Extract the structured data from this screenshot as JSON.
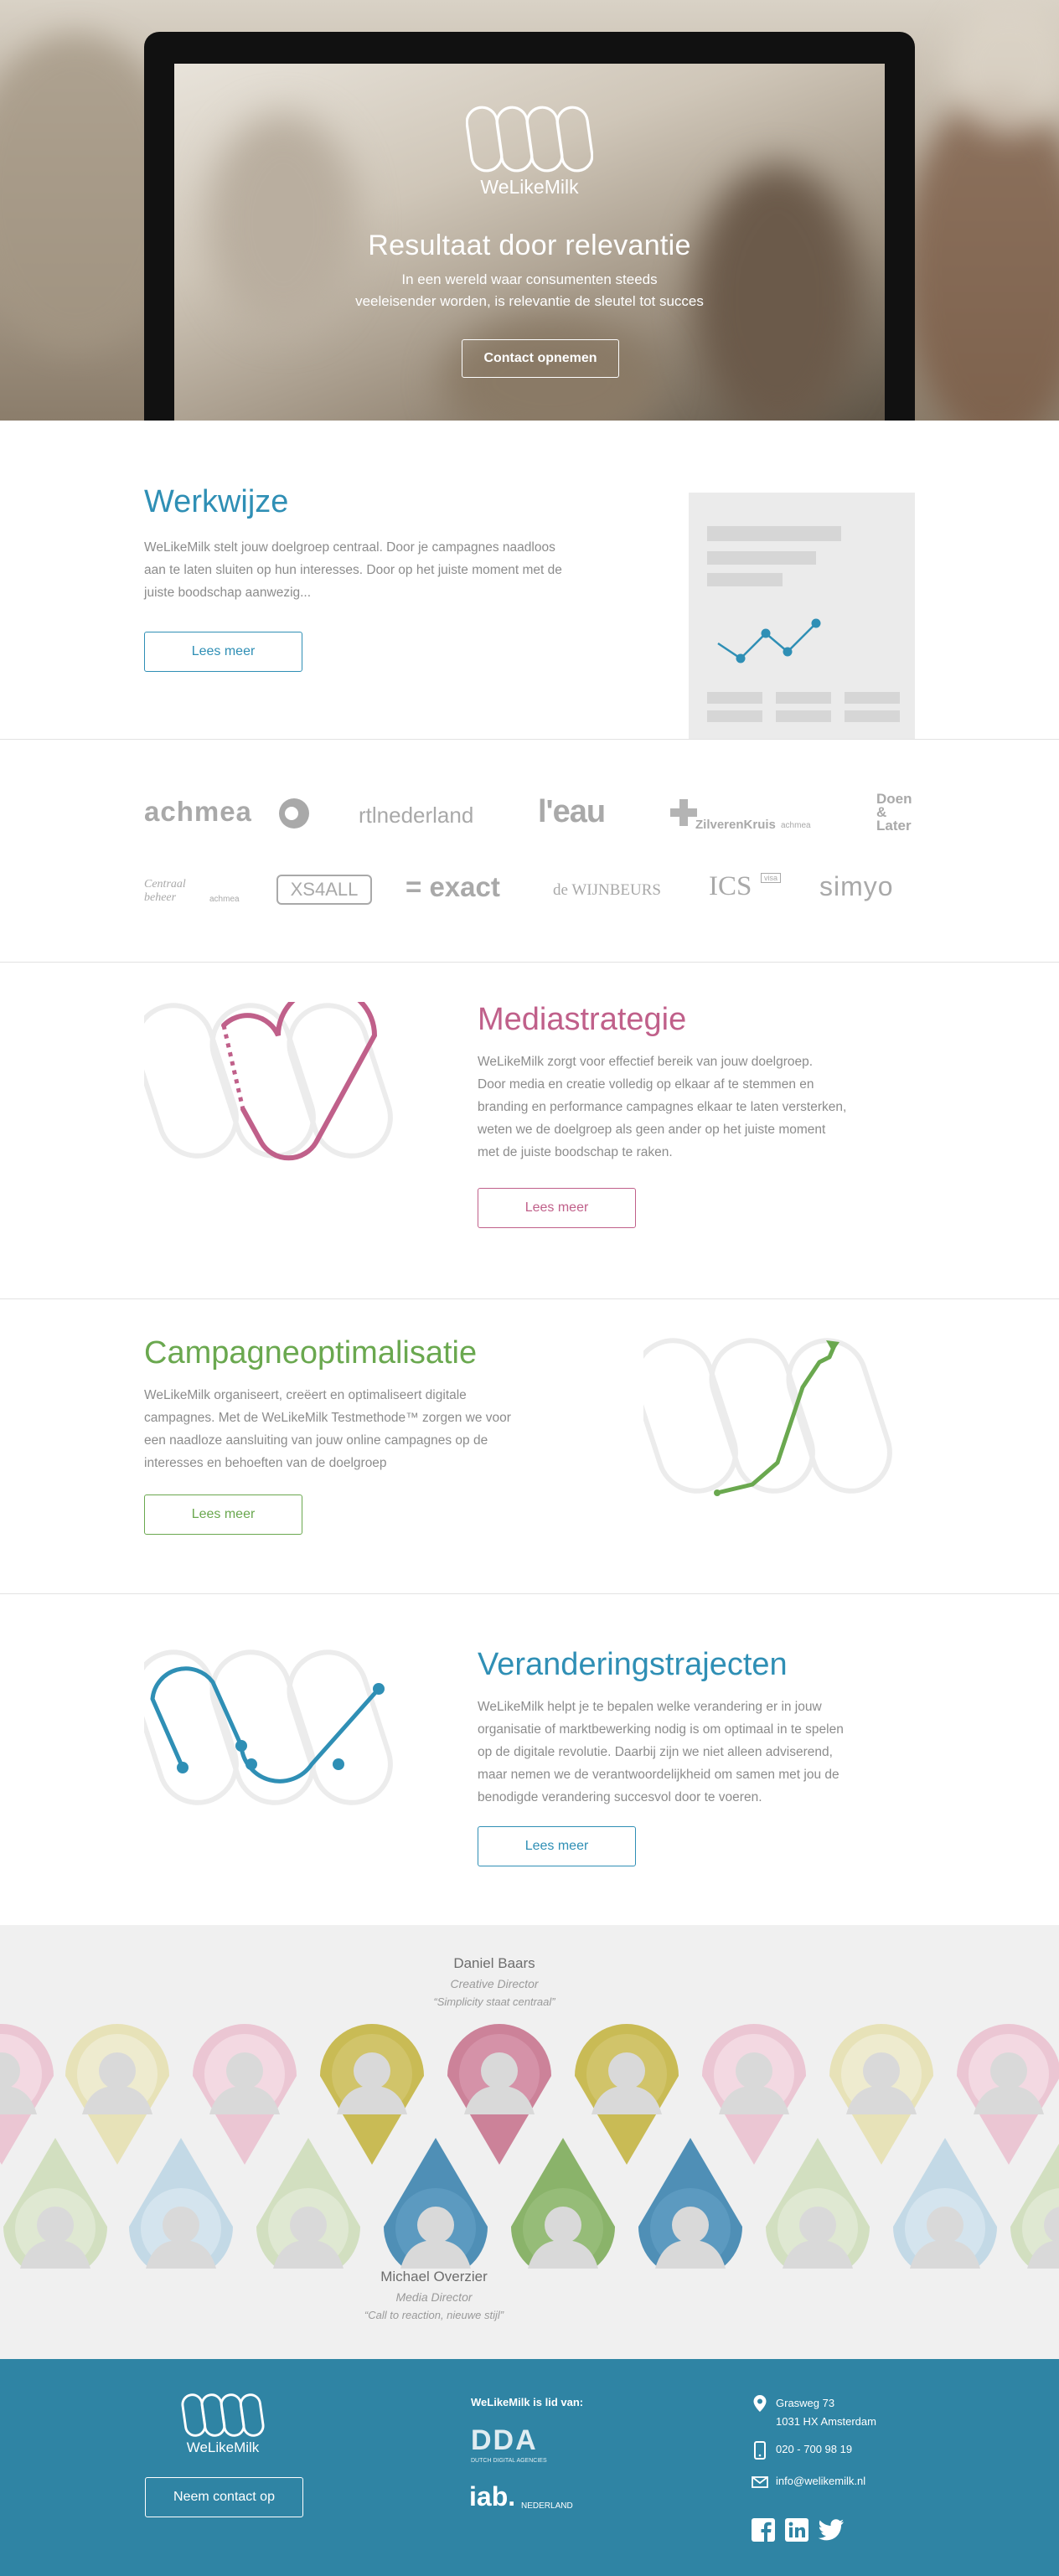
{
  "hero": {
    "brand": "WeLikeMilk",
    "title": "Resultaat door relevantie",
    "subtitle_line1": "In een wereld waar consumenten steeds",
    "subtitle_line2": "veeleisender worden, is relevantie de sleutel tot succes",
    "cta": "Contact opnemen"
  },
  "werkwijze": {
    "title": "Werkwijze",
    "lines": [
      "WeLikeMilk stelt jouw doelgroep centraal. Door je campagnes naadloos",
      "aan te laten sluiten op hun interesses. Door op het juiste moment met de",
      "juiste boodschap aanwezig..."
    ],
    "button": "Lees meer",
    "color": "#2f8fb5"
  },
  "clients": {
    "row1": [
      "achmea",
      "rtlnederland",
      "l'eau",
      "ZilverenKruis",
      "achmea",
      "Doen",
      "&",
      "Later"
    ],
    "row2": [
      "Centraal",
      "beheer",
      "achmea",
      "XS4ALL",
      "= exact",
      "de WIJNBEURS",
      "ICS",
      "visa",
      "simyo"
    ]
  },
  "mediastrategie": {
    "title": "Mediastrategie",
    "lines": [
      "WeLikeMilk zorgt voor effectief bereik van jouw doelgroep.",
      "Door media en creatie volledig op elkaar af te stemmen en",
      "branding en performance campagnes elkaar te laten versterken,",
      "weten we de doelgroep als geen ander op het juiste moment",
      "met de juiste boodschap te raken."
    ],
    "button": "Lees meer",
    "color": "#c0608a"
  },
  "campagne": {
    "title": "Campagneoptimalisatie",
    "lines": [
      "WeLikeMilk organiseert, creëert en optimaliseert digitale",
      "campagnes. Met de WeLikeMilk Testmethode™ zorgen we voor",
      "een naadloze aansluiting van jouw online campagnes op de",
      "interesses en behoeften van de doelgroep"
    ],
    "button": "Lees meer",
    "color": "#6aa84f"
  },
  "verandering": {
    "title": "Veranderingstrajecten",
    "lines": [
      "WeLikeMilk helpt je te bepalen welke verandering er in jouw",
      "organisatie of marktbewerking nodig is om optimaal in te spelen",
      "op de digitale revolutie. Daarbij zijn we niet alleen adviserend,",
      "maar nemen we de verantwoordelijkheid om samen met jou de",
      "benodigde verandering succesvol door te voeren."
    ],
    "button": "Lees meer",
    "color": "#2f8fb5"
  },
  "team": {
    "top_person": {
      "name": "Daniel Baars",
      "role": "Creative Director",
      "quote": "“Simplicity staat centraal”"
    },
    "bottom_person": {
      "name": "Michael Overzier",
      "role": "Media Director",
      "quote": "“Call to reaction, nieuwe stijl”"
    }
  },
  "footer": {
    "brand": "WeLikeMilk",
    "contact_button": "Neem contact op",
    "member_label": "WeLikeMilk is lid van:",
    "dda_label": "DDA",
    "dda_sub": "DUTCH DIGITAL AGENCIES",
    "iab_label": "iab.",
    "iab_sub": "NEDERLAND",
    "address_line1": "Grasweg 73",
    "address_line2": "1031 HX Amsterdam",
    "phone": "020 - 700 98 19",
    "email": "info@welikemilk.nl"
  }
}
